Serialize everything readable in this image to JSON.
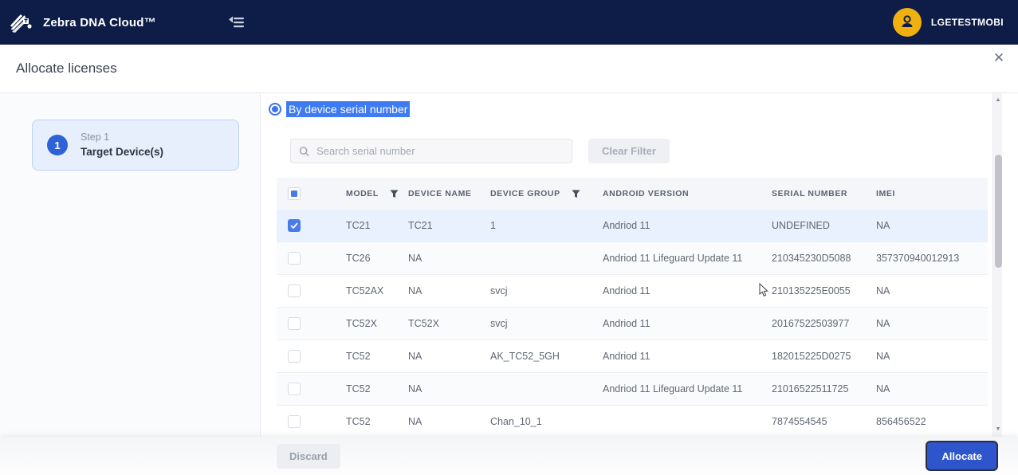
{
  "topbar": {
    "brand": "Zebra DNA Cloud™",
    "user": "LGETESTMOBI"
  },
  "dialog": {
    "title": "Allocate licenses",
    "close_label": "✕"
  },
  "step": {
    "number": "1",
    "label": "Step 1",
    "title": "Target Device(s)"
  },
  "filter": {
    "radio_label": "By device serial number",
    "search_placeholder": "Search serial number",
    "clear_button": "Clear Filter"
  },
  "table": {
    "header": {
      "model": "MODEL",
      "device_name": "DEVICE NAME",
      "device_group": "DEVICE GROUP",
      "android_version": "ANDROID VERSION",
      "serial_number": "SERIAL NUMBER",
      "imei": "IMEI"
    },
    "rows": [
      {
        "checked": true,
        "model": "TC21",
        "device_name": "TC21",
        "device_group": "1",
        "android_version": "Andriod 11",
        "serial": "UNDEFINED",
        "imei": "NA"
      },
      {
        "checked": false,
        "model": "TC26",
        "device_name": "NA",
        "device_group": "",
        "android_version": "Andriod 11 Lifeguard Update 11",
        "serial": "210345230D5088",
        "imei": "357370940012913"
      },
      {
        "checked": false,
        "model": "TC52AX",
        "device_name": "NA",
        "device_group": "svcj",
        "android_version": "Andriod 11",
        "serial": "210135225E0055",
        "imei": "NA"
      },
      {
        "checked": false,
        "model": "TC52X",
        "device_name": "TC52X",
        "device_group": "svcj",
        "android_version": "Andriod 11",
        "serial": "20167522503977",
        "imei": "NA"
      },
      {
        "checked": false,
        "model": "TC52",
        "device_name": "NA",
        "device_group": "AK_TC52_5GH",
        "android_version": "Andriod 11",
        "serial": "182015225D0275",
        "imei": "NA"
      },
      {
        "checked": false,
        "model": "TC52",
        "device_name": "NA",
        "device_group": "",
        "android_version": "Andriod 11 Lifeguard Update 11",
        "serial": "21016522511725",
        "imei": "NA"
      },
      {
        "checked": false,
        "model": "TC52",
        "device_name": "NA",
        "device_group": "Chan_10_1",
        "android_version": "",
        "serial": "7874554545",
        "imei": "856456522"
      }
    ]
  },
  "footer": {
    "discard": "Discard",
    "allocate": "Allocate"
  },
  "scrollbar": {
    "up": "▲",
    "down": "▼"
  },
  "colors": {
    "topbar_navy": "#0e1d47",
    "accent_blue": "#2e55cb",
    "checkbox_blue": "#4a7bea",
    "selection_highlight": "#3e7bf2",
    "selected_row": "#e9f1fe",
    "avatar_amber": "#efb010"
  }
}
